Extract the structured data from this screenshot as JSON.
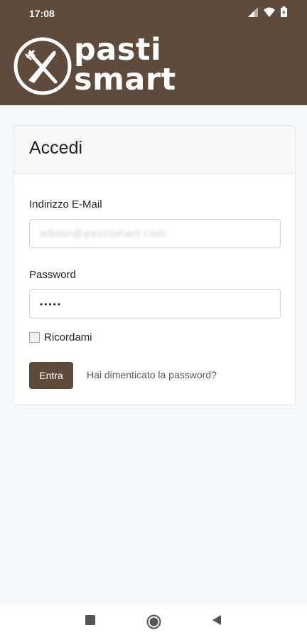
{
  "status_bar": {
    "time": "17:08",
    "icons": [
      "signal-icon",
      "wifi-icon",
      "battery-icon"
    ]
  },
  "brand": {
    "line1": "pasti",
    "line2": "smart",
    "logo_icon": "fork-knife-plate-icon",
    "header_color": "#5e4b3c"
  },
  "login": {
    "title": "Accedi",
    "email_label": "Indirizzo E-Mail",
    "email_value": "admin@pastismart.com",
    "password_label": "Password",
    "password_value": "•••••",
    "remember_label": "Ricordami",
    "remember_checked": false,
    "submit_label": "Entra",
    "forgot_label": "Hai dimenticato la password?"
  },
  "nav": {
    "buttons": [
      "recents-icon",
      "home-icon",
      "back-icon"
    ]
  }
}
